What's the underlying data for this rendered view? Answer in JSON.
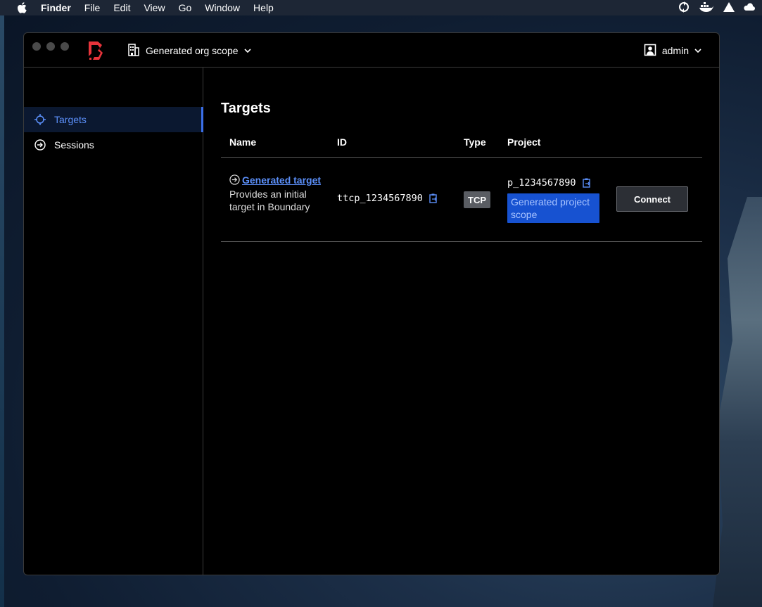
{
  "menubar": {
    "app": "Finder",
    "items": [
      "File",
      "Edit",
      "View",
      "Go",
      "Window",
      "Help"
    ]
  },
  "header": {
    "org_scope": "Generated org scope",
    "user": "admin"
  },
  "sidebar": {
    "items": [
      {
        "label": "Targets",
        "icon": "crosshair-icon",
        "active": true
      },
      {
        "label": "Sessions",
        "icon": "arrow-circle-icon",
        "active": false
      }
    ]
  },
  "main": {
    "title": "Targets",
    "columns": [
      "Name",
      "ID",
      "Type",
      "Project"
    ],
    "rows": [
      {
        "name": "Generated target",
        "description": "Provides an initial target in Boundary",
        "id": "ttcp_1234567890",
        "type": "TCP",
        "project_id": "p_1234567890",
        "project_name": "Generated project scope",
        "action": "Connect"
      }
    ]
  },
  "colors": {
    "accent": "#5b8ff9",
    "project_badge": "#1752d1",
    "logo": "#e8343b"
  }
}
